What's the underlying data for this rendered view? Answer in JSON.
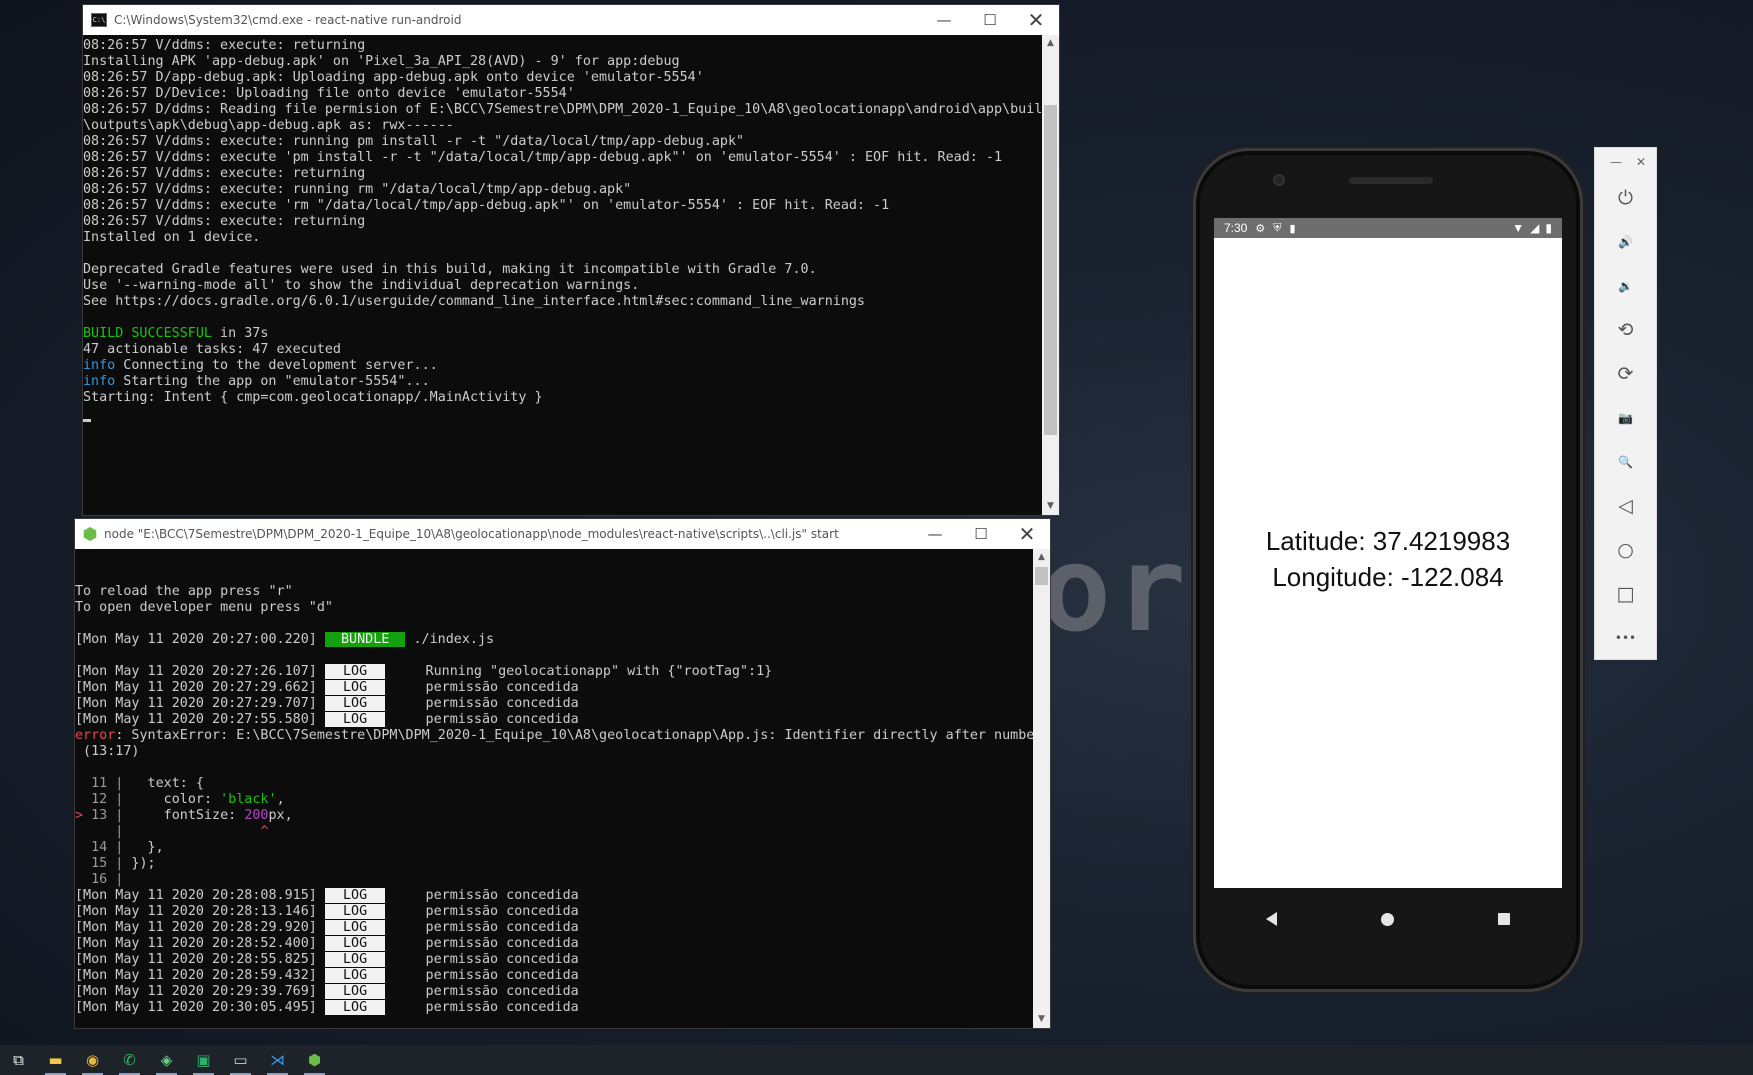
{
  "background_word": "orl",
  "cmd_window": {
    "title": "C:\\Windows\\System32\\cmd.exe - react-native  run-android",
    "lines": [
      [
        {
          "t": "08:26:57 V/ddms: execute: returning"
        }
      ],
      [
        {
          "t": "Installing APK 'app-debug.apk' on 'Pixel_3a_API_28(AVD) - 9' for app:debug"
        }
      ],
      [
        {
          "t": "08:26:57 D/app-debug.apk: Uploading app-debug.apk onto device 'emulator-5554'"
        }
      ],
      [
        {
          "t": "08:26:57 D/Device: Uploading file onto device 'emulator-5554'"
        }
      ],
      [
        {
          "t": "08:26:57 D/ddms: Reading file permision of E:\\BCC\\7Semestre\\DPM\\DPM_2020-1_Equipe_10\\A8\\geolocationapp\\android\\app\\build"
        }
      ],
      [
        {
          "t": "\\outputs\\apk\\debug\\app-debug.apk as: rwx------"
        }
      ],
      [
        {
          "t": "08:26:57 V/ddms: execute: running pm install -r -t \"/data/local/tmp/app-debug.apk\""
        }
      ],
      [
        {
          "t": "08:26:57 V/ddms: execute 'pm install -r -t \"/data/local/tmp/app-debug.apk\"' on 'emulator-5554' : EOF hit. Read: -1"
        }
      ],
      [
        {
          "t": "08:26:57 V/ddms: execute: returning"
        }
      ],
      [
        {
          "t": "08:26:57 V/ddms: execute: running rm \"/data/local/tmp/app-debug.apk\""
        }
      ],
      [
        {
          "t": "08:26:57 V/ddms: execute 'rm \"/data/local/tmp/app-debug.apk\"' on 'emulator-5554' : EOF hit. Read: -1"
        }
      ],
      [
        {
          "t": "08:26:57 V/ddms: execute: returning"
        }
      ],
      [
        {
          "t": "Installed on 1 device."
        }
      ],
      [
        {
          "t": ""
        }
      ],
      [
        {
          "t": "Deprecated Gradle features were used in this build, making it incompatible with Gradle 7.0."
        }
      ],
      [
        {
          "t": "Use '--warning-mode all' to show the individual deprecation warnings."
        }
      ],
      [
        {
          "t": "See https://docs.gradle.org/6.0.1/userguide/command_line_interface.html#sec:command_line_warnings"
        }
      ],
      [
        {
          "t": ""
        }
      ],
      [
        {
          "t": "BUILD SUCCESSFUL",
          "c": "green"
        },
        {
          "t": " in 37s"
        }
      ],
      [
        {
          "t": "47 actionable tasks: 47 executed"
        }
      ],
      [
        {
          "t": "info",
          "c": "cyan"
        },
        {
          "t": " Connecting to the development server..."
        }
      ],
      [
        {
          "t": "info",
          "c": "cyan"
        },
        {
          "t": " Starting the app on \"emulator-5554\"..."
        }
      ],
      [
        {
          "t": "Starting: Intent { cmp=com.geolocationapp/.MainActivity }"
        }
      ]
    ]
  },
  "node_window": {
    "title": "node  \"E:\\BCC\\7Semestre\\DPM\\DPM_2020-1_Equipe_10\\A8\\geolocationapp\\node_modules\\react-native\\scripts\\..\\cli.js\" start",
    "lines": [
      [
        {
          "t": ""
        }
      ],
      [
        {
          "t": ""
        }
      ],
      [
        {
          "t": "To reload the app press \"r\""
        }
      ],
      [
        {
          "t": "To open developer menu press \"d\""
        }
      ],
      [
        {
          "t": ""
        }
      ],
      [
        {
          "t": "[Mon May 11 2020 20:27:00.220] "
        },
        {
          "t": " BUNDLE ",
          "c": "badge-bundle"
        },
        {
          "t": " ./index.js"
        }
      ],
      [
        {
          "t": ""
        }
      ],
      [
        {
          "t": "[Mon May 11 2020 20:27:26.107] "
        },
        {
          "t": " LOG ",
          "c": "badge-log"
        },
        {
          "t": "     Running \"geolocationapp\" with {\"rootTag\":1}"
        }
      ],
      [
        {
          "t": "[Mon May 11 2020 20:27:29.662] "
        },
        {
          "t": " LOG ",
          "c": "badge-log"
        },
        {
          "t": "     permissão concedida"
        }
      ],
      [
        {
          "t": "[Mon May 11 2020 20:27:29.707] "
        },
        {
          "t": " LOG ",
          "c": "badge-log"
        },
        {
          "t": "     permissão concedida"
        }
      ],
      [
        {
          "t": "[Mon May 11 2020 20:27:55.580] "
        },
        {
          "t": " LOG ",
          "c": "badge-log"
        },
        {
          "t": "     permissão concedida"
        }
      ],
      [
        {
          "t": "error",
          "c": "red"
        },
        {
          "t": ": SyntaxError: E:\\BCC\\7Semestre\\DPM\\DPM_2020-1_Equipe_10\\A8\\geolocationapp\\App.js: Identifier directly after number"
        }
      ],
      [
        {
          "t": " (13:17)"
        }
      ],
      [
        {
          "t": ""
        }
      ],
      [
        {
          "t": "  11 |",
          "c": "gray"
        },
        {
          "t": "   text: {"
        }
      ],
      [
        {
          "t": "  12 |",
          "c": "gray"
        },
        {
          "t": "     color: "
        },
        {
          "t": "'black'",
          "c": "str"
        },
        {
          "t": ","
        }
      ],
      [
        {
          "t": "> ",
          "c": "red"
        },
        {
          "t": "13 |",
          "c": "gray"
        },
        {
          "t": "     fontSize: "
        },
        {
          "t": "200",
          "c": "num"
        },
        {
          "t": "px,"
        }
      ],
      [
        {
          "t": "     |",
          "c": "gray"
        },
        {
          "t": "                 "
        },
        {
          "t": "^",
          "c": "red"
        }
      ],
      [
        {
          "t": "  14 |",
          "c": "gray"
        },
        {
          "t": "   },"
        }
      ],
      [
        {
          "t": "  15 |",
          "c": "gray"
        },
        {
          "t": " });"
        }
      ],
      [
        {
          "t": "  16 |",
          "c": "gray"
        }
      ],
      [
        {
          "t": "[Mon May 11 2020 20:28:08.915] "
        },
        {
          "t": " LOG ",
          "c": "badge-log"
        },
        {
          "t": "     permissão concedida"
        }
      ],
      [
        {
          "t": "[Mon May 11 2020 20:28:13.146] "
        },
        {
          "t": " LOG ",
          "c": "badge-log"
        },
        {
          "t": "     permissão concedida"
        }
      ],
      [
        {
          "t": "[Mon May 11 2020 20:28:29.920] "
        },
        {
          "t": " LOG ",
          "c": "badge-log"
        },
        {
          "t": "     permissão concedida"
        }
      ],
      [
        {
          "t": "[Mon May 11 2020 20:28:52.400] "
        },
        {
          "t": " LOG ",
          "c": "badge-log"
        },
        {
          "t": "     permissão concedida"
        }
      ],
      [
        {
          "t": "[Mon May 11 2020 20:28:55.825] "
        },
        {
          "t": " LOG ",
          "c": "badge-log"
        },
        {
          "t": "     permissão concedida"
        }
      ],
      [
        {
          "t": "[Mon May 11 2020 20:28:59.432] "
        },
        {
          "t": " LOG ",
          "c": "badge-log"
        },
        {
          "t": "     permissão concedida"
        }
      ],
      [
        {
          "t": "[Mon May 11 2020 20:29:39.769] "
        },
        {
          "t": " LOG ",
          "c": "badge-log"
        },
        {
          "t": "     permissão concedida"
        }
      ],
      [
        {
          "t": "[Mon May 11 2020 20:30:05.495] "
        },
        {
          "t": " LOG ",
          "c": "badge-log"
        },
        {
          "t": "     permissão concedida"
        }
      ]
    ]
  },
  "emulator": {
    "status_time": "7:30",
    "latitude_text": "Latitude: 37.4219983",
    "longitude_text": "Longitude: -122.084",
    "toolbar": [
      {
        "name": "power-icon",
        "glyph": "⏻"
      },
      {
        "name": "volume-up-icon",
        "glyph": "🔊"
      },
      {
        "name": "volume-down-icon",
        "glyph": "🔉"
      },
      {
        "name": "rotate-left-icon",
        "glyph": "⟲"
      },
      {
        "name": "rotate-right-icon",
        "glyph": "⟳"
      },
      {
        "name": "camera-icon",
        "glyph": "📷"
      },
      {
        "name": "zoom-icon",
        "glyph": "🔍"
      },
      {
        "name": "back-icon",
        "glyph": "◁"
      },
      {
        "name": "home-icon",
        "glyph": "○"
      },
      {
        "name": "overview-icon",
        "glyph": "□"
      },
      {
        "name": "more-icon",
        "glyph": "•••"
      }
    ]
  },
  "window_controls": {
    "minimize": "—",
    "maximize": "☐",
    "close": "✕"
  },
  "taskbar": [
    {
      "name": "task-view-icon",
      "glyph": "⧉",
      "color": "#ffffff"
    },
    {
      "name": "file-explorer-icon",
      "glyph": "▬",
      "color": "#f3c94b"
    },
    {
      "name": "chrome-icon",
      "glyph": "◉",
      "color": "#e5b83a"
    },
    {
      "name": "whatsapp-icon",
      "glyph": "✆",
      "color": "#2fc25a"
    },
    {
      "name": "android-studio-icon",
      "glyph": "◈",
      "color": "#6bd08c"
    },
    {
      "name": "app-icon",
      "glyph": "▣",
      "color": "#2fb06e"
    },
    {
      "name": "cmd-icon",
      "glyph": "▭",
      "color": "#d0d0d0"
    },
    {
      "name": "vscode-icon",
      "glyph": "⋊",
      "color": "#3a9ae6"
    },
    {
      "name": "node-icon",
      "glyph": "⬢",
      "color": "#6cbd45"
    }
  ]
}
